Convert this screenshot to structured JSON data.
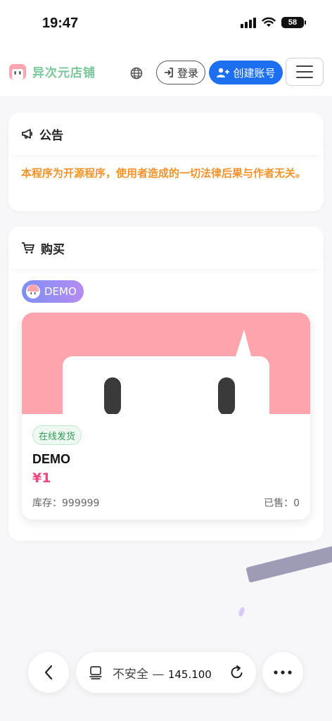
{
  "status_bar": {
    "time": "19:47",
    "battery": "58"
  },
  "navbar": {
    "brand": "异次元店铺",
    "login_label": "登录",
    "register_label": "创建账号",
    "icons": [
      "globe-icon",
      "login-icon",
      "user-plus-icon",
      "hamburger-icon"
    ]
  },
  "notice": {
    "title": "公告",
    "text": "本程序为开源程序，使用者造成的一切法律后果与作者无关。"
  },
  "shop": {
    "title": "购买",
    "category": "DEMO",
    "product": {
      "tag": "在线发货",
      "name": "DEMO",
      "price": "¥1",
      "stock": "库存：999999",
      "sold": "已售：0"
    }
  },
  "browser": {
    "url_prefix": "不安全 — ",
    "url_host": "145.100"
  },
  "colors": {
    "brand": "#7ac79a",
    "primary": "#1d6ff2",
    "notice": "#f0932b",
    "price": "#ec4a7f",
    "product_bg": "#fda4ad"
  }
}
